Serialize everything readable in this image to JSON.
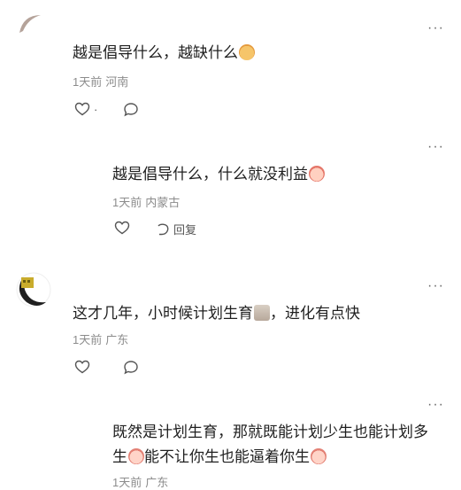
{
  "comments": [
    {
      "text": "越是倡导什么，越缺什么",
      "time": "1天前",
      "location": "河南",
      "like_count": "·",
      "more_label": "···",
      "emoji": "emoji-grin",
      "avatar": "avatar-crescent"
    },
    {
      "text": "越是倡导什么，什么就没利益",
      "time": "1天前",
      "location": "内蒙古",
      "reply_label": "回复",
      "more_label": "···",
      "emoji": "emoji-blush"
    },
    {
      "text_before": "这才几年，小时候计划生育",
      "text_after": "，进化有点快",
      "time": "1天前",
      "location": "广东",
      "more_label": "···",
      "emoji": "emoji-sticker",
      "avatar": "avatar-moon-night"
    },
    {
      "text_line1": "既然是计划生育，那就既能计划少生也能计划多",
      "text_line2_a": "生",
      "text_line2_b": "能不让你生也能逼着你生",
      "time": "1天前",
      "location": "广东",
      "more_label": "···",
      "emoji": "emoji-cry"
    }
  ],
  "colors": {
    "text": "#1f1f1f",
    "meta": "#8c8c8c",
    "icon": "#555555"
  }
}
